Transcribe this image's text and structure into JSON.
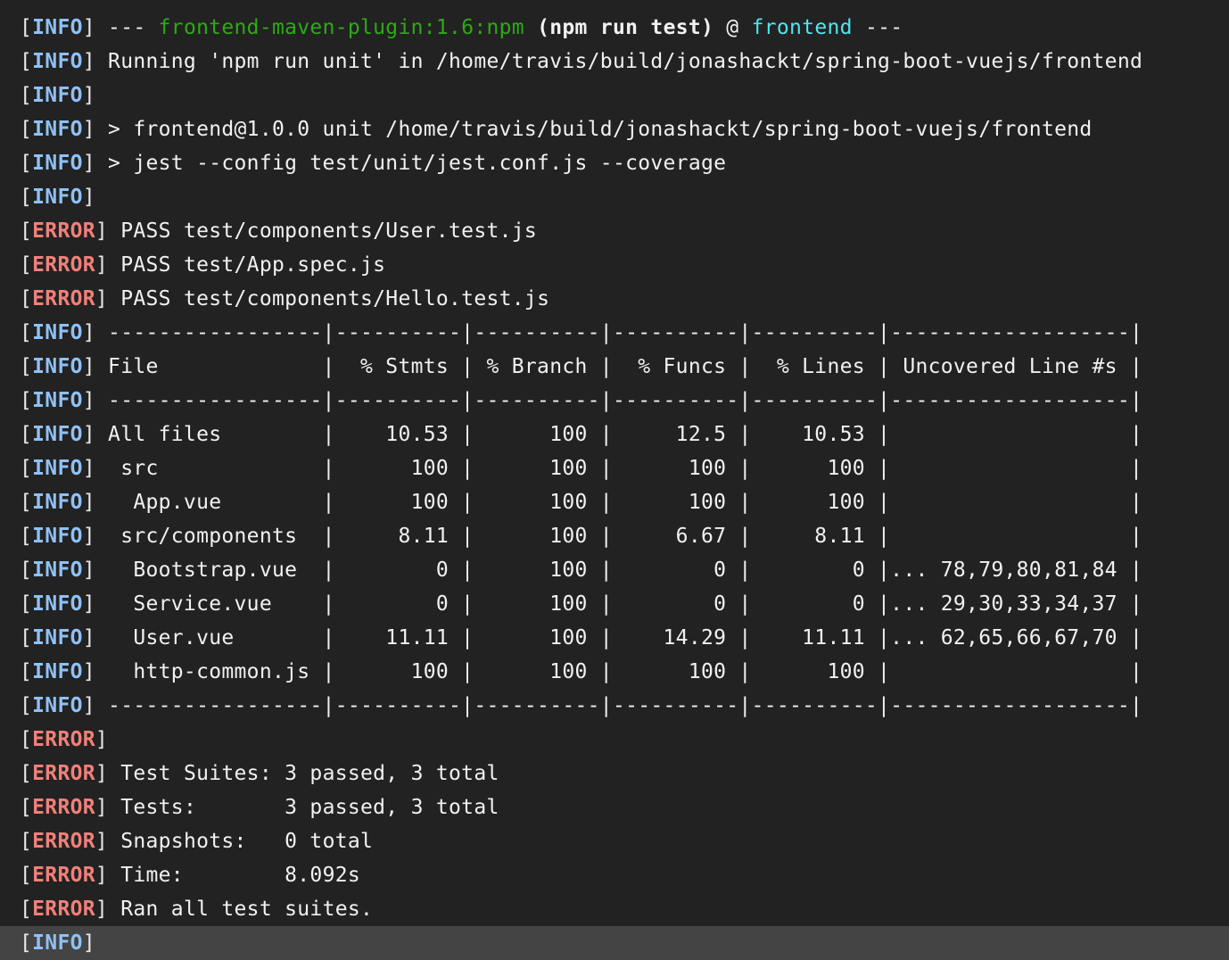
{
  "colors": {
    "background": "#222222",
    "info_level": "#8fc1f5",
    "error_level": "#f0807a",
    "plugin_green": "#2eaa16",
    "project_cyan": "#4fe6f0",
    "text": "#f1f1f1",
    "highlight_row": "#444444"
  },
  "lines": [
    {
      "level": "INFO",
      "segments": [
        {
          "text": " --- ",
          "style": "plain"
        },
        {
          "text": "frontend-maven-plugin:1.6:npm",
          "style": "green"
        },
        {
          "text": " ",
          "style": "plain"
        },
        {
          "text": "(npm run test)",
          "style": "bold"
        },
        {
          "text": " @ ",
          "style": "plain"
        },
        {
          "text": "frontend",
          "style": "cyan"
        },
        {
          "text": " ---",
          "style": "plain"
        }
      ]
    },
    {
      "level": "INFO",
      "segments": [
        {
          "text": " Running 'npm run unit' in /home/travis/build/jonashackt/spring-boot-vuejs/frontend",
          "style": "plain"
        }
      ]
    },
    {
      "level": "INFO",
      "segments": []
    },
    {
      "level": "INFO",
      "segments": [
        {
          "text": " > frontend@1.0.0 unit /home/travis/build/jonashackt/spring-boot-vuejs/frontend",
          "style": "plain"
        }
      ]
    },
    {
      "level": "INFO",
      "segments": [
        {
          "text": " > jest --config test/unit/jest.conf.js --coverage",
          "style": "plain"
        }
      ]
    },
    {
      "level": "INFO",
      "segments": []
    },
    {
      "level": "ERROR",
      "segments": [
        {
          "text": " PASS test/components/User.test.js",
          "style": "plain"
        }
      ]
    },
    {
      "level": "ERROR",
      "segments": [
        {
          "text": " PASS test/App.spec.js",
          "style": "plain"
        }
      ]
    },
    {
      "level": "ERROR",
      "segments": [
        {
          "text": " PASS test/components/Hello.test.js",
          "style": "plain"
        }
      ]
    },
    {
      "level": "INFO",
      "segments": [
        {
          "text": " -----------------|----------|----------|----------|----------|-------------------|",
          "style": "plain"
        }
      ]
    },
    {
      "level": "INFO",
      "segments": [
        {
          "text": " File             |  % Stmts | % Branch |  % Funcs |  % Lines | Uncovered Line #s |",
          "style": "plain"
        }
      ]
    },
    {
      "level": "INFO",
      "segments": [
        {
          "text": " -----------------|----------|----------|----------|----------|-------------------|",
          "style": "plain"
        }
      ]
    },
    {
      "level": "INFO",
      "segments": [
        {
          "text": " All files        |    10.53 |      100 |     12.5 |    10.53 |                   |",
          "style": "plain"
        }
      ]
    },
    {
      "level": "INFO",
      "segments": [
        {
          "text": "  src             |      100 |      100 |      100 |      100 |                   |",
          "style": "plain"
        }
      ]
    },
    {
      "level": "INFO",
      "segments": [
        {
          "text": "   App.vue        |      100 |      100 |      100 |      100 |                   |",
          "style": "plain"
        }
      ]
    },
    {
      "level": "INFO",
      "segments": [
        {
          "text": "  src/components  |     8.11 |      100 |     6.67 |     8.11 |                   |",
          "style": "plain"
        }
      ]
    },
    {
      "level": "INFO",
      "segments": [
        {
          "text": "   Bootstrap.vue  |        0 |      100 |        0 |        0 |... 78,79,80,81,84 |",
          "style": "plain"
        }
      ]
    },
    {
      "level": "INFO",
      "segments": [
        {
          "text": "   Service.vue    |        0 |      100 |        0 |        0 |... 29,30,33,34,37 |",
          "style": "plain"
        }
      ]
    },
    {
      "level": "INFO",
      "segments": [
        {
          "text": "   User.vue       |    11.11 |      100 |    14.29 |    11.11 |... 62,65,66,67,70 |",
          "style": "plain"
        }
      ]
    },
    {
      "level": "INFO",
      "segments": [
        {
          "text": "   http-common.js |      100 |      100 |      100 |      100 |                   |",
          "style": "plain"
        }
      ]
    },
    {
      "level": "INFO",
      "segments": [
        {
          "text": " -----------------|----------|----------|----------|----------|-------------------|",
          "style": "plain"
        }
      ]
    },
    {
      "level": "ERROR",
      "segments": []
    },
    {
      "level": "ERROR",
      "segments": [
        {
          "text": " Test Suites: 3 passed, 3 total",
          "style": "plain"
        }
      ]
    },
    {
      "level": "ERROR",
      "segments": [
        {
          "text": " Tests:       3 passed, 3 total",
          "style": "plain"
        }
      ]
    },
    {
      "level": "ERROR",
      "segments": [
        {
          "text": " Snapshots:   0 total",
          "style": "plain"
        }
      ]
    },
    {
      "level": "ERROR",
      "segments": [
        {
          "text": " Time:        8.092s",
          "style": "plain"
        }
      ]
    },
    {
      "level": "ERROR",
      "segments": [
        {
          "text": " Ran all test suites.",
          "style": "plain"
        }
      ]
    },
    {
      "level": "INFO",
      "segments": [],
      "highlighted": true
    }
  ],
  "coverage_table": {
    "headers": [
      "File",
      "% Stmts",
      "% Branch",
      "% Funcs",
      "% Lines",
      "Uncovered Line #s"
    ],
    "rows": [
      [
        "All files",
        "10.53",
        "100",
        "12.5",
        "10.53",
        ""
      ],
      [
        "src",
        "100",
        "100",
        "100",
        "100",
        ""
      ],
      [
        "App.vue",
        "100",
        "100",
        "100",
        "100",
        ""
      ],
      [
        "src/components",
        "8.11",
        "100",
        "6.67",
        "8.11",
        ""
      ],
      [
        "Bootstrap.vue",
        "0",
        "100",
        "0",
        "0",
        "... 78,79,80,81,84"
      ],
      [
        "Service.vue",
        "0",
        "100",
        "0",
        "0",
        "... 29,30,33,34,37"
      ],
      [
        "User.vue",
        "11.11",
        "100",
        "14.29",
        "11.11",
        "... 62,65,66,67,70"
      ],
      [
        "http-common.js",
        "100",
        "100",
        "100",
        "100",
        ""
      ]
    ]
  }
}
